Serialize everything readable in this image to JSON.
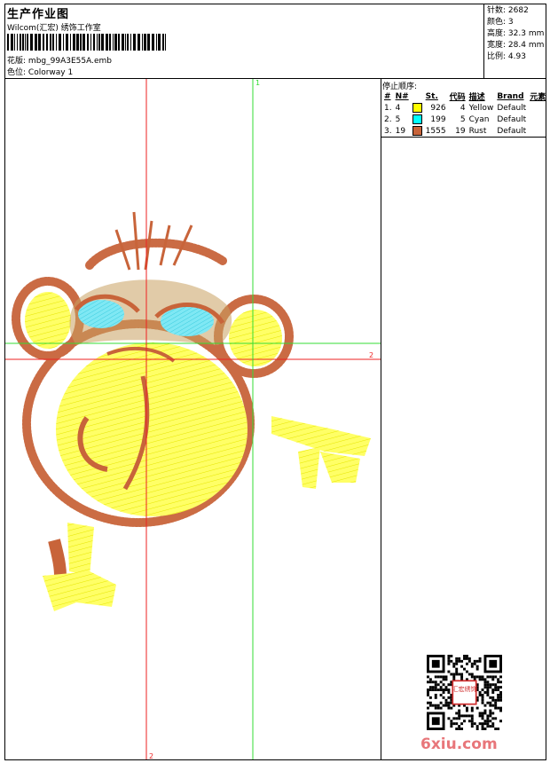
{
  "header": {
    "title": "生产作业图",
    "company": "Wilcom(汇宏) 绣饰工作室",
    "design_label": "花版:",
    "design_value": "mbg_99A3E55A.emb",
    "colorway_label": "色位:",
    "colorway_value": "Colorway 1"
  },
  "stats": [
    {
      "label": "针数:",
      "value": "2682"
    },
    {
      "label": "颜色:",
      "value": "3"
    },
    {
      "label": "高度:",
      "value": "32.3 mm"
    },
    {
      "label": "宽度:",
      "value": "28.4 mm"
    },
    {
      "label": "比例:",
      "value": "4.93"
    }
  ],
  "stop_sequence": {
    "title": "停止顺序:",
    "headers": [
      "#",
      "N#",
      "",
      "St.",
      "代码",
      "描述",
      "Brand",
      "元素"
    ],
    "rows": [
      {
        "idx": "1.",
        "n": "4",
        "color": "#ffff00",
        "st": "926",
        "code": "4",
        "desc": "Yellow",
        "brand": "Default"
      },
      {
        "idx": "2.",
        "n": "5",
        "color": "#00ffff",
        "st": "199",
        "code": "5",
        "desc": "Cyan",
        "brand": "Default"
      },
      {
        "idx": "3.",
        "n": "19",
        "color": "#c8643a",
        "st": "1555",
        "code": "19",
        "desc": "Rust",
        "brand": "Default"
      }
    ]
  },
  "guides": {
    "green_vertical_label": "1",
    "red_horizontal_label": "2",
    "red_vertical_label": "2"
  },
  "watermark": {
    "text": "6xiu.com",
    "stamp_text": "汇宏绣饰"
  },
  "colors": {
    "yellow": "#ffff00",
    "cyan": "#55e0f0",
    "rust": "#c8643a",
    "guide_red": "#ee2222",
    "guide_green": "#33dd33"
  }
}
